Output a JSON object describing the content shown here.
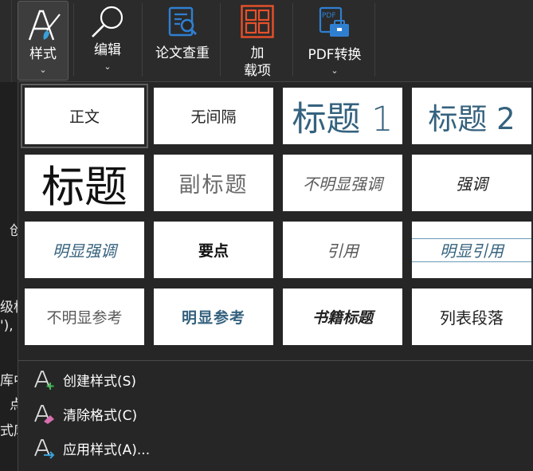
{
  "ribbon": {
    "styles_label": "样式",
    "edit_label": "编辑",
    "check_label": "论文查重",
    "addins_label_1": "加",
    "addins_label_2": "载项",
    "pdf_label": "PDF转换",
    "pdf_icon_text": "PDF",
    "chevron": "⌄"
  },
  "doc_text": [
    "创",
    "级标",
    "'),",
    "库中",
    "点",
    "式库"
  ],
  "styles": [
    "正文",
    "无间隔",
    "标题 1",
    "标题 2",
    "标题",
    "副标题",
    "不明显强调",
    "强调",
    "明显强调",
    "要点",
    "引用",
    "明显引用",
    "不明显参考",
    "明显参考",
    "书籍标题",
    "列表段落"
  ],
  "commands": {
    "create": "创建样式(S)",
    "clear": "清除格式(C)",
    "apply": "应用样式(A)..."
  },
  "colors": {
    "accent_blue": "#35627e",
    "ribbon_bg": "#2b2b2b",
    "gallery_bg": "#262626",
    "addins_orange": "#e8512a",
    "check_blue": "#2f7fd1"
  }
}
